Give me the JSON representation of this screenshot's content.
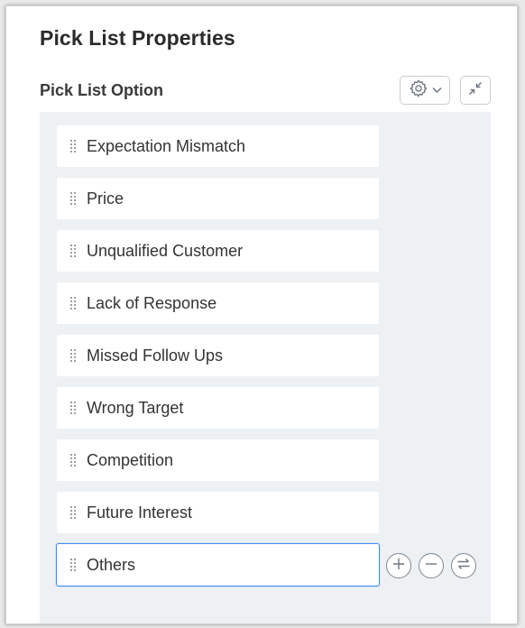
{
  "header": {
    "title": "Pick List Properties",
    "section_label": "Pick List Option"
  },
  "toolbar": {
    "settings_icon": "gear-icon",
    "dropdown_icon": "chevron-down-icon",
    "collapse_icon": "collapse-arrows-icon"
  },
  "options": [
    {
      "label": "Expectation Mismatch"
    },
    {
      "label": "Price"
    },
    {
      "label": "Unqualified Customer"
    },
    {
      "label": "Lack of Response"
    },
    {
      "label": "Missed Follow Ups"
    },
    {
      "label": "Wrong Target"
    },
    {
      "label": "Competition"
    },
    {
      "label": "Future Interest"
    }
  ],
  "editing_option": {
    "value": "Others"
  },
  "row_actions": {
    "add_icon": "plus-circle-icon",
    "remove_icon": "minus-circle-icon",
    "swap_icon": "swap-arrows-icon"
  },
  "colors": {
    "options_bg": "#eef1f4",
    "focus_border": "#3d8ef0",
    "icon_gray": "#7f8790"
  }
}
